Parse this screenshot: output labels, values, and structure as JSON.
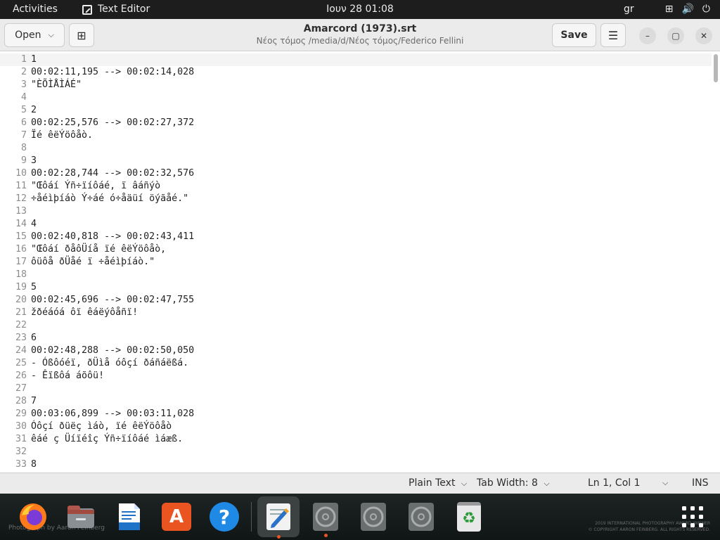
{
  "topbar": {
    "activities": "Activities",
    "app_name": "Text Editor",
    "clock": "Ιουν 28  01:08",
    "lang": "gr",
    "tray": {
      "network_icon": "⊞",
      "volume_icon": "🔊",
      "power_icon": "⏻"
    }
  },
  "header": {
    "open_label": "Open",
    "open_chevron": "⌵",
    "new_tab_icon": "⊞",
    "title": "Amarcord (1973).srt",
    "subtitle": "Νέος τόμος /media/d/Νέος τόμος/Federico Fellini",
    "save_label": "Save",
    "menu_icon": "☰",
    "min_icon": "–",
    "max_icon": "▢",
    "close_icon": "✕"
  },
  "editor": {
    "lines": [
      {
        "n": "1",
        "t": "1"
      },
      {
        "n": "2",
        "t": "00:02:11,195 --> 00:02:14,028"
      },
      {
        "n": "3",
        "t": "\"ÈÕÌÅÌÁÉ\""
      },
      {
        "n": "4",
        "t": ""
      },
      {
        "n": "5",
        "t": "2"
      },
      {
        "n": "6",
        "t": "00:02:25,576 --> 00:02:27,372"
      },
      {
        "n": "7",
        "t": "Ïé êëÝöôåò."
      },
      {
        "n": "8",
        "t": ""
      },
      {
        "n": "9",
        "t": "3"
      },
      {
        "n": "10",
        "t": "00:02:28,744 --> 00:02:32,576"
      },
      {
        "n": "11",
        "t": "\"Œôáí Ýñ÷ïíôáé, ï âáñýò"
      },
      {
        "n": "12",
        "t": "÷åéìþíáò Ý÷áé ó÷åäüí öýãåé.\""
      },
      {
        "n": "13",
        "t": ""
      },
      {
        "n": "14",
        "t": "4"
      },
      {
        "n": "15",
        "t": "00:02:40,818 --> 00:02:43,411"
      },
      {
        "n": "16",
        "t": "\"Œôáí ðåôÜíå ïé êëÝöôåò,"
      },
      {
        "n": "17",
        "t": "ôüôå ðÜåé ï ÷åéìþíáò.\""
      },
      {
        "n": "18",
        "t": ""
      },
      {
        "n": "19",
        "t": "5"
      },
      {
        "n": "20",
        "t": "00:02:45,696 --> 00:02:47,755"
      },
      {
        "n": "21",
        "t": "žðéáóá ôï êáëýôåñï!"
      },
      {
        "n": "22",
        "t": ""
      },
      {
        "n": "23",
        "t": "6"
      },
      {
        "n": "24",
        "t": "00:02:48,288 --> 00:02:50,050"
      },
      {
        "n": "25",
        "t": "- Óßôóéï, ðÜìå óôçí ðáñáëßá."
      },
      {
        "n": "26",
        "t": "- Êïßôá áõôü!"
      },
      {
        "n": "27",
        "t": ""
      },
      {
        "n": "28",
        "t": "7"
      },
      {
        "n": "29",
        "t": "00:03:06,899 --> 00:03:11,028"
      },
      {
        "n": "30",
        "t": "Óôçí ðüëç ìáò, ïé êëÝöôåò"
      },
      {
        "n": "31",
        "t": "êáé ç Üíïéîç Ýñ÷ïíôáé ìáæß."
      },
      {
        "n": "32",
        "t": ""
      },
      {
        "n": "33",
        "t": "8"
      }
    ]
  },
  "statusbar": {
    "language": "Plain Text",
    "tab_width": "Tab Width: 8",
    "position": "Ln 1, Col 1",
    "chevron": "⌵",
    "mode": "INS"
  },
  "watermark": {
    "left": "Photograph by Aaron Feinberg",
    "right_line1": "2019 INTERNATIONAL PHOTOGRAPHY AWARD WINNER",
    "right_line2": "© COPYRIGHT AARON FEINBERG. ALL RIGHTS RESERVED."
  },
  "dock": {
    "apps": [
      {
        "name": "Firefox",
        "icon": "firefox-icon"
      },
      {
        "name": "Files",
        "icon": "files-icon"
      },
      {
        "name": "LibreOffice Writer",
        "icon": "writer-icon"
      },
      {
        "name": "Ubuntu Software",
        "icon": "software-icon"
      },
      {
        "name": "Help",
        "icon": "help-icon"
      },
      {
        "name": "Text Editor",
        "icon": "text-editor-icon"
      },
      {
        "name": "Disc",
        "icon": "disc-icon"
      },
      {
        "name": "Disc",
        "icon": "disc-icon"
      },
      {
        "name": "Disc",
        "icon": "disc-icon"
      },
      {
        "name": "Trash",
        "icon": "trash-icon"
      },
      {
        "name": "Show Applications",
        "icon": "app-grid-icon"
      }
    ],
    "help_glyph": "?",
    "software_glyph": "A",
    "trash_glyph": "♻"
  },
  "colors": {
    "accent": "#e95420",
    "topbar": "#1d1d1d",
    "headerbar": "#ebebeb"
  }
}
